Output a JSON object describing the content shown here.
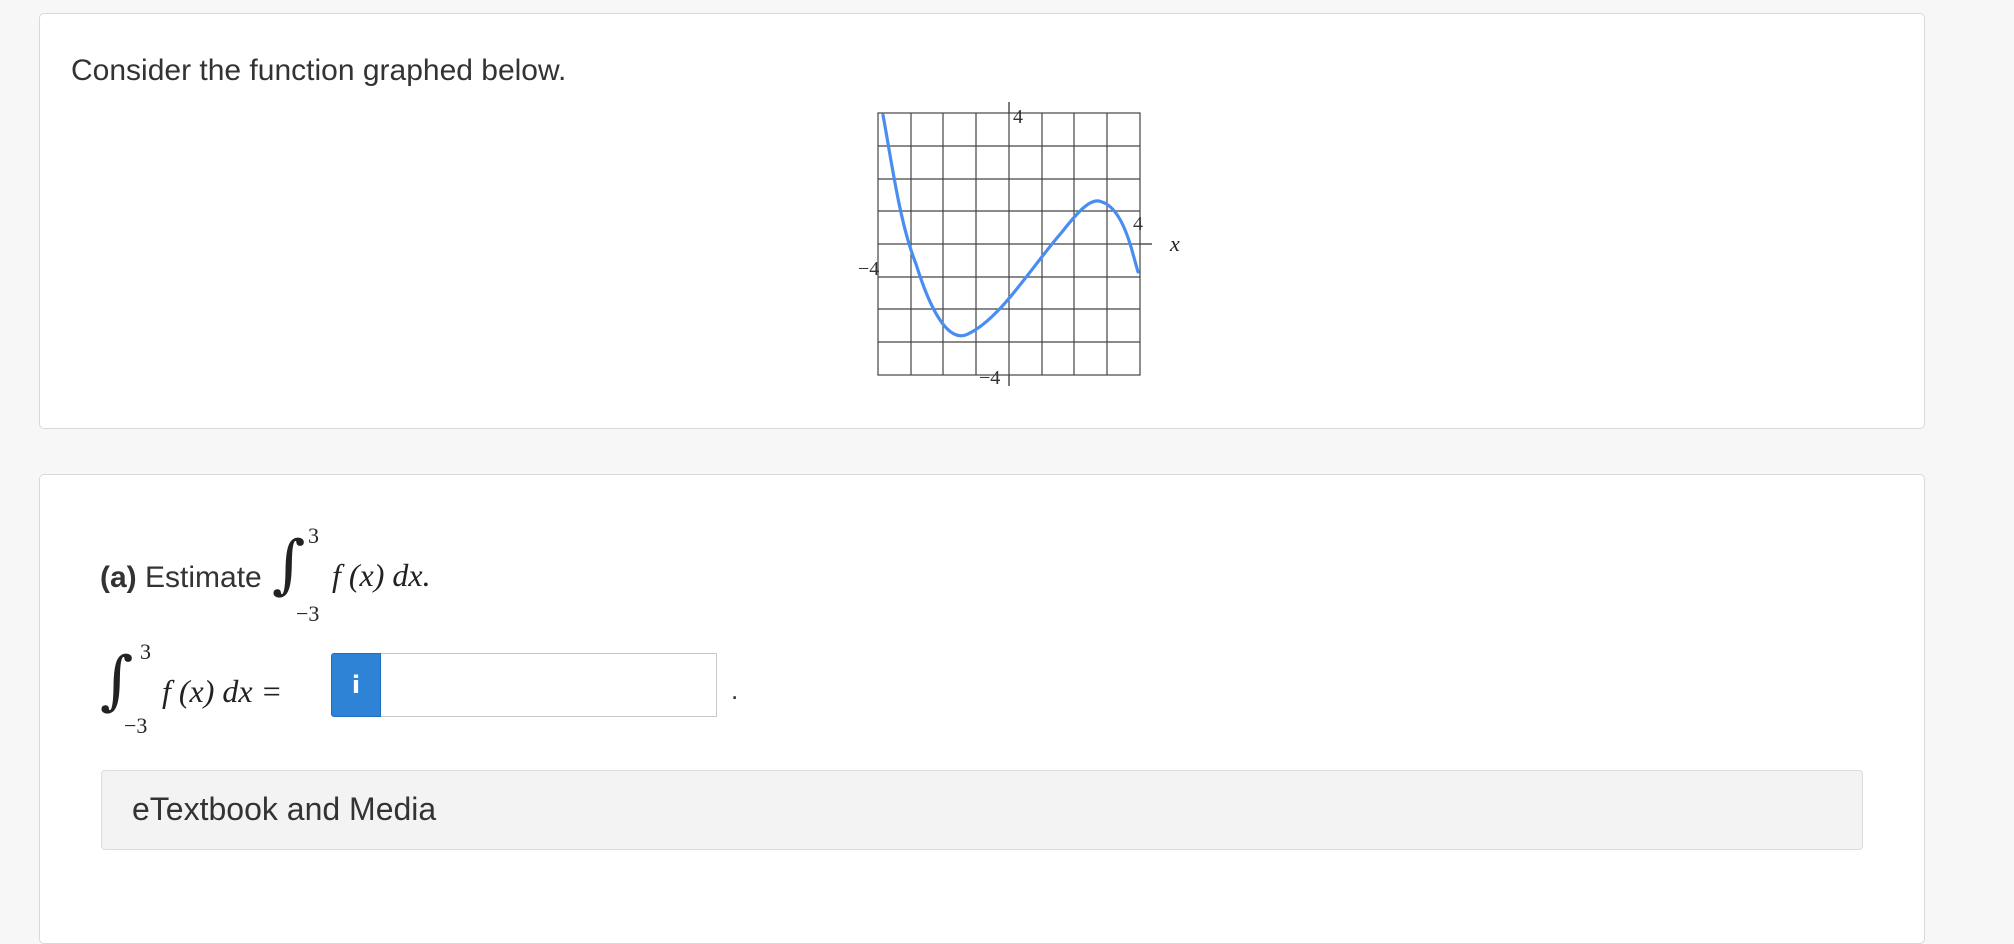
{
  "intro": {
    "text": "Consider the function graphed below."
  },
  "graph": {
    "tick_top": "4",
    "tick_bottom": "−4",
    "tick_left": "−4",
    "tick_right": "4",
    "x_axis_label": "x",
    "curve_color": "#4a8df0"
  },
  "part_a": {
    "label_bold": "(a)",
    "label_text": " Estimate",
    "integral": {
      "upper": "3",
      "lower": "−3",
      "integrand": "f (x) dx.",
      "integrand_eq": "f (x) dx ="
    },
    "info_icon": "i",
    "answer_value": "",
    "trailing": "."
  },
  "etextbook": {
    "label": "eTextbook and Media"
  }
}
